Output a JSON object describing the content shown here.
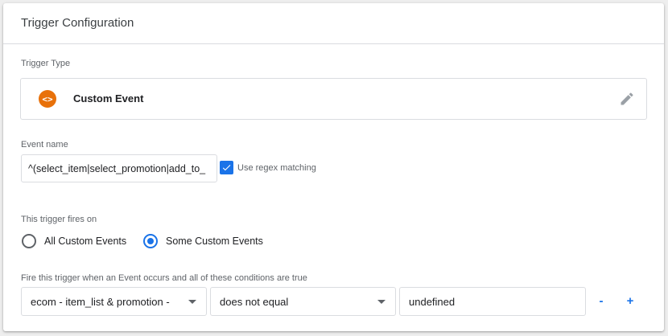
{
  "card": {
    "title": "Trigger Configuration"
  },
  "trigger_type": {
    "label": "Trigger Type",
    "icon": "code-brackets-icon",
    "icon_glyph": "<>",
    "icon_color": "#e8710a",
    "name": "Custom Event"
  },
  "event_name": {
    "label": "Event name",
    "value": "^(select_item|select_promotion|add_to_",
    "regex_checked": true,
    "regex_label": "Use regex matching"
  },
  "fires_on": {
    "label": "This trigger fires on",
    "options": [
      {
        "label": "All Custom Events",
        "selected": false
      },
      {
        "label": "Some Custom Events",
        "selected": true
      }
    ]
  },
  "conditions": {
    "label": "Fire this trigger when an Event occurs and all of these conditions are true",
    "variable": "ecom - item_list & promotion -",
    "operator": "does not equal",
    "value": "undefined",
    "remove_label": "-",
    "add_label": "+"
  },
  "colors": {
    "accent": "#1a73e8",
    "icon_orange": "#e8710a",
    "border": "#dadce0"
  }
}
